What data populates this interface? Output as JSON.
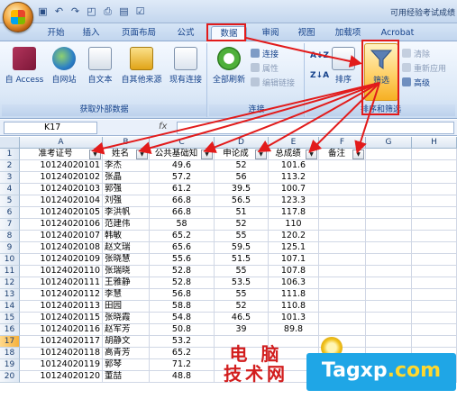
{
  "titlebar": {
    "title": "可用经验考试成绩"
  },
  "tabs": [
    {
      "label": "开始",
      "active": false
    },
    {
      "label": "插入",
      "active": false
    },
    {
      "label": "页面布局",
      "active": false
    },
    {
      "label": "公式",
      "active": false
    },
    {
      "label": "数据",
      "active": true
    },
    {
      "label": "审阅",
      "active": false
    },
    {
      "label": "视图",
      "active": false
    },
    {
      "label": "加载项",
      "active": false
    },
    {
      "label": "Acrobat",
      "active": false
    }
  ],
  "ribbon": {
    "external_group": {
      "label": "获取外部数据",
      "buttons": [
        "自 Access",
        "自网站",
        "自文本",
        "自其他来源",
        "现有连接"
      ]
    },
    "connections_group": {
      "label": "连接",
      "refresh_label": "全部刷新",
      "connections_label": "连接",
      "properties_label": "属性",
      "edit_links_label": "编辑链接"
    },
    "sort_group": {
      "label": "排序和筛选",
      "sort_label": "排序",
      "filter_label": "筛选",
      "clear_label": "清除",
      "reapply_label": "重新应用",
      "advanced_label": "高级"
    }
  },
  "formula_bar": {
    "name_box": "K17",
    "fx": "fx",
    "value": ""
  },
  "grid": {
    "columns": [
      "A",
      "B",
      "C",
      "D",
      "E",
      "F",
      "G",
      "H"
    ],
    "header": [
      "准考证号",
      "姓名",
      "公共基础知",
      "申论成",
      "总成绩",
      "备注"
    ],
    "rows": [
      [
        "10124020101",
        "李杰",
        "49.6",
        "52",
        "101.6"
      ],
      [
        "10124020102",
        "张晶",
        "57.2",
        "56",
        "113.2"
      ],
      [
        "10124020103",
        "郭强",
        "61.2",
        "39.5",
        "100.7"
      ],
      [
        "10124020104",
        "刘强",
        "66.8",
        "56.5",
        "123.3"
      ],
      [
        "10124020105",
        "李洪帆",
        "66.8",
        "51",
        "117.8"
      ],
      [
        "10124020106",
        "范建伟",
        "58",
        "52",
        "110"
      ],
      [
        "10124020107",
        "韩敏",
        "65.2",
        "55",
        "120.2"
      ],
      [
        "10124020108",
        "赵文瑞",
        "65.6",
        "59.5",
        "125.1"
      ],
      [
        "10124020109",
        "张晓慧",
        "55.6",
        "51.5",
        "107.1"
      ],
      [
        "10124020110",
        "张瑞晓",
        "52.8",
        "55",
        "107.8"
      ],
      [
        "10124020111",
        "王雅静",
        "52.8",
        "53.5",
        "106.3"
      ],
      [
        "10124020112",
        "李慧",
        "56.8",
        "55",
        "111.8"
      ],
      [
        "10124020113",
        "田园",
        "58.8",
        "52",
        "110.8"
      ],
      [
        "10124020115",
        "张晓霞",
        "54.8",
        "46.5",
        "101.3"
      ],
      [
        "10124020116",
        "赵军芳",
        "50.8",
        "39",
        "89.8"
      ],
      [
        "10124020117",
        "胡静文",
        "53.2",
        "",
        ""
      ],
      [
        "10124020118",
        "高青芳",
        "65.2",
        "",
        ""
      ],
      [
        "10124020119",
        "郭琴",
        "71.2",
        "",
        ""
      ],
      [
        "10124020120",
        "董喆",
        "48.8",
        "",
        ""
      ]
    ]
  },
  "watermark": {
    "cn_line1": "电 脑",
    "cn_line2": "技术网",
    "en_prefix": "Tagxp",
    "en_suffix": ".com"
  },
  "colors": {
    "accent_red": "#e21b1b",
    "ribbon_blue": "#15428b",
    "watermark_blue": "#1fa6e6"
  }
}
